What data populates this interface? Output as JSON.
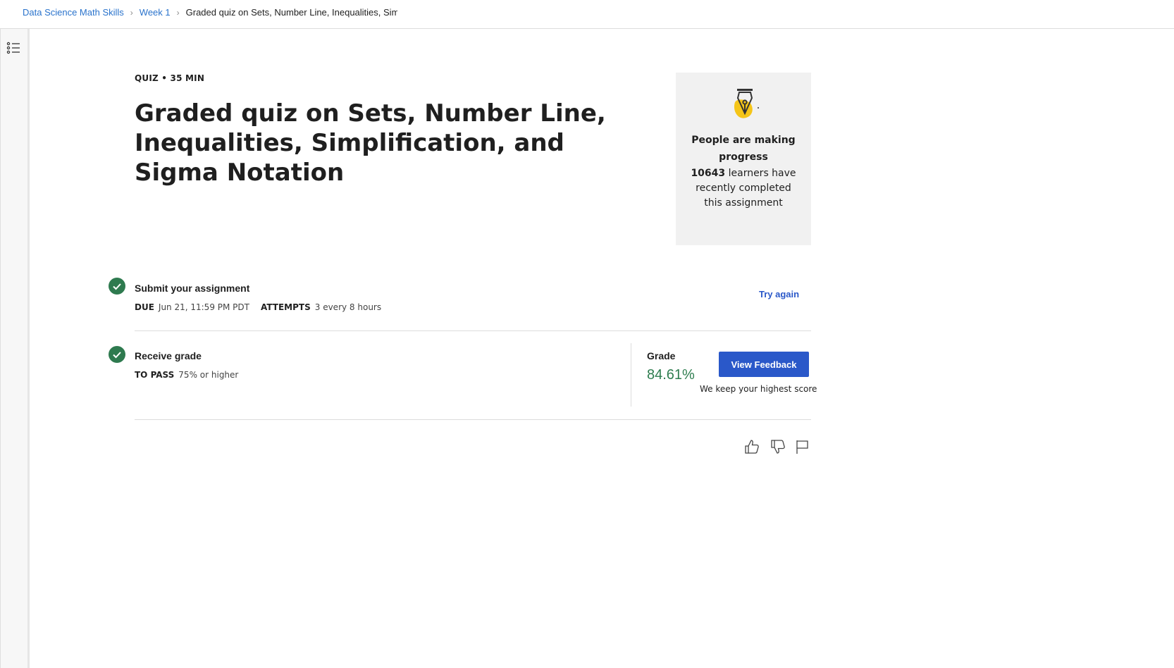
{
  "breadcrumb": {
    "course": "Data Science Math Skills",
    "week": "Week 1",
    "current": "Graded quiz on Sets, Number Line, Inequalities, Simplificati"
  },
  "sidebar": {
    "outline_icon": "list-outline-icon"
  },
  "quiz": {
    "meta": "QUIZ • 35 MIN",
    "title": "Graded quiz on Sets, Number Line, Inequalities, Simplification, and Sigma Notation"
  },
  "progress_card": {
    "icon": "pen-nib-icon",
    "heading": "People are making progress",
    "count": "10643",
    "body": " learners have recently completed this assignment"
  },
  "submit_step": {
    "title": "Submit your assignment",
    "due_key": "DUE",
    "due_value": "Jun 21, 11:59 PM PDT",
    "attempts_key": "ATTEMPTS",
    "attempts_value": "3 every 8 hours",
    "action": "Try again"
  },
  "grade_step": {
    "title": "Receive grade",
    "pass_key": "TO PASS",
    "pass_value": "75% or higher",
    "grade_label": "Grade",
    "grade_value": "84.61%",
    "feedback_button": "View Feedback",
    "note": "We keep your highest score"
  },
  "colors": {
    "link": "#2a73cc",
    "primary_button": "#2a58c9",
    "success": "#2e7d4f",
    "check": "#2e7a4f",
    "card_bg": "#f1f1f1",
    "pen_yellow": "#f5c518"
  }
}
